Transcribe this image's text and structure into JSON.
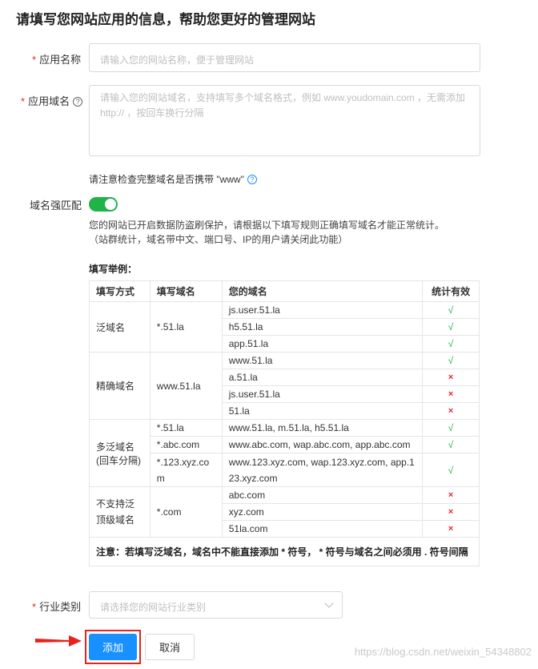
{
  "page_title": "请填写您网站应用的信息，帮助您更好的管理网站",
  "form": {
    "app_name": {
      "required": "*",
      "label": "应用名称",
      "placeholder": "请输入您的网站名称，便于管理网站"
    },
    "app_domain": {
      "required": "*",
      "label": "应用域名",
      "help_icon": "question-circle-icon",
      "placeholder_line1": "请输入您的网站域名，支持填写多个域名格式，例如 www.youdomain.com ，无需添加",
      "placeholder_line2": "http:// ，按回车换行分隔"
    },
    "www_hint": "请注意检查完整域名是否携带 \"www\"",
    "strict_match": {
      "label": "域名强匹配",
      "toggle_on": true,
      "desc_line1": "您的网站已开启数据防盗刷保护，请根据以下填写规则正确填写域名才能正常统计。",
      "desc_line2": "（站群统计，域名带中文、端口号、IP的用户请关闭此功能）"
    },
    "example": {
      "title": "填写举例：",
      "headers": [
        "填写方式",
        "填写域名",
        "您的域名",
        "统计有效"
      ],
      "groups": {
        "g1": {
          "method": "泛域名",
          "domain": "*.51.la",
          "rows": [
            {
              "yours": "js.user.51.la",
              "valid": "√"
            },
            {
              "yours": "h5.51.la",
              "valid": "√"
            },
            {
              "yours": "app.51.la",
              "valid": "√"
            }
          ]
        },
        "g2": {
          "method": "精确域名",
          "domain": "www.51.la",
          "rows": [
            {
              "yours": "www.51.la",
              "valid": "√"
            },
            {
              "yours": "a.51.la",
              "valid": "×"
            },
            {
              "yours": "js.user.51.la",
              "valid": "×"
            },
            {
              "yours": "51.la",
              "valid": "×"
            }
          ]
        },
        "g3": {
          "method_line1": "多泛域名",
          "method_line2": "(回车分隔)",
          "rows": [
            {
              "domain": "*.51.la",
              "yours": "www.51.la, m.51.la, h5.51.la",
              "valid": "√"
            },
            {
              "domain": "*.abc.com",
              "yours": "www.abc.com, wap.abc.com, app.abc.com",
              "valid": "√"
            },
            {
              "domain_line1": "*.123.xyz.co",
              "domain_line2": "m",
              "yours_line1": "www.123.xyz.com, wap.123.xyz.com, app.1",
              "yours_line2": "23.xyz.com",
              "valid": "√"
            }
          ]
        },
        "g4": {
          "method_line1": "不支持泛",
          "method_line2": "顶级域名",
          "domain": "*.com",
          "rows": [
            {
              "yours": "abc.com",
              "valid": "×"
            },
            {
              "yours": "xyz.com",
              "valid": "×"
            },
            {
              "yours": "51la.com",
              "valid": "×"
            }
          ]
        }
      },
      "note": "注意：若填写泛域名，域名中不能直接添加 * 符号， * 符号与域名之间必须用 . 符号间隔"
    },
    "industry": {
      "required": "*",
      "label": "行业类别",
      "placeholder": "请选择您的网站行业类别"
    }
  },
  "buttons": {
    "add": "添加",
    "cancel": "取消"
  },
  "watermark": "https://blog.csdn.net/weixin_54348802",
  "colors": {
    "primary": "#1890ff",
    "toggle": "#1fb34a",
    "required": "#f5222d",
    "highlight": "#e8221b"
  }
}
